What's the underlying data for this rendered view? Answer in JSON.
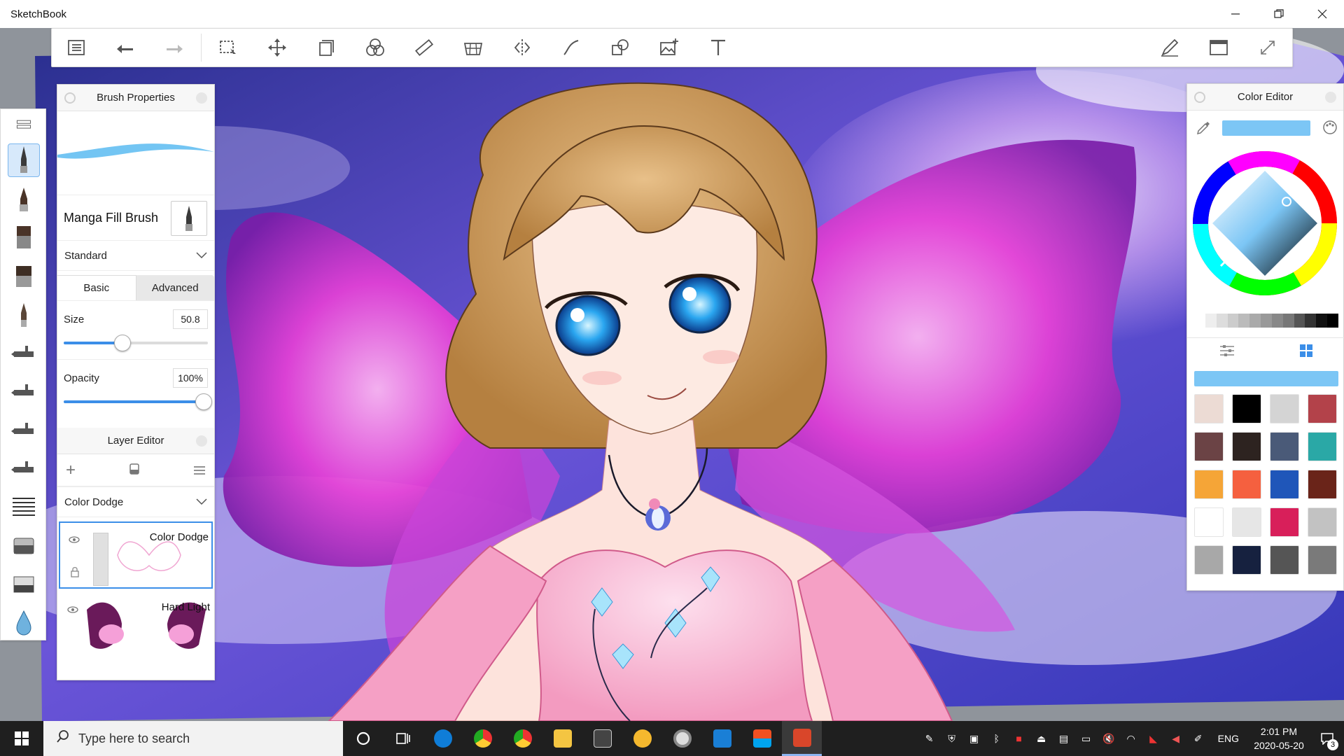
{
  "window": {
    "title": "SketchBook",
    "minimize_icon": "minimize-icon",
    "restore_icon": "restore-icon",
    "close_icon": "close-icon"
  },
  "toolbar": {
    "left_tools": [
      "menu-list-icon",
      "undo-icon",
      "redo-icon"
    ],
    "tools": [
      "select-icon",
      "transform-icon",
      "layer-copy-icon",
      "color-blend-icon",
      "ruler-icon",
      "perspective-icon",
      "symmetry-icon",
      "curve-icon",
      "shape-icon",
      "image-add-icon",
      "text-icon"
    ],
    "right_tools": [
      "brush-edit-icon",
      "window-icon",
      "fullscreen-icon"
    ]
  },
  "toolstrip": {
    "items": [
      "brush-library-icon",
      "manga-fill-brush-icon",
      "ink-brush-icon",
      "flat-brush-icon",
      "wide-brush-icon",
      "pencil-brush-icon",
      "airbrush-1-icon",
      "airbrush-2-icon",
      "airbrush-3-icon",
      "airbrush-4-icon",
      "hatch-brush-icon",
      "eraser-soft-icon",
      "eraser-hard-icon",
      "blur-drop-icon"
    ],
    "active_index": 1
  },
  "brush_panel": {
    "title": "Brush Properties",
    "brush_name": "Manga Fill Brush",
    "preset": "Standard",
    "tab_basic": "Basic",
    "tab_advanced": "Advanced",
    "size_label": "Size",
    "size_value": "50.8",
    "size_fraction": 0.42,
    "opacity_label": "Opacity",
    "opacity_value": "100%",
    "opacity_fraction": 1.0
  },
  "layer_editor": {
    "title": "Layer Editor",
    "blend_mode": "Color Dodge",
    "layers": [
      {
        "name": "Color Dodge",
        "selected": true
      },
      {
        "name": "Hard Light",
        "selected": false
      }
    ]
  },
  "color_editor": {
    "title": "Color Editor",
    "current_color": "#7cc6f5",
    "gray_ramp": [
      "#ffffff",
      "#eeeeee",
      "#dddddd",
      "#cccccc",
      "#bbbbbb",
      "#aaaaaa",
      "#999999",
      "#888888",
      "#777777",
      "#555555",
      "#333333",
      "#111111",
      "#000000"
    ],
    "swatches": [
      "#ecdbd4",
      "#000000",
      "#d4d4d4",
      "#b3424a",
      "#6b4345",
      "#2d2320",
      "#4a5a78",
      "#2aa8a6",
      "#f5a537",
      "#f5603f",
      "#1f56b9",
      "#6a2419",
      "#ffffff",
      "#e6e6e6",
      "#d81f5a",
      "#c2c2c2",
      "#a8a8a8",
      "#16213f",
      "#555555",
      "#7a7a7a"
    ]
  },
  "taskbar": {
    "search_placeholder": "Type here to search",
    "apps": [
      "cortana-icon",
      "task-view-icon",
      "edge-icon",
      "chrome-icon",
      "chrome-2-icon",
      "file-explorer-icon",
      "calculator-icon",
      "weather-icon",
      "media-icon",
      "meet-icon",
      "store-icon",
      "sketchbook-icon"
    ],
    "tray_lang": "ENG",
    "time": "2:01 PM",
    "date": "2020-05-20",
    "notification_count": "3"
  }
}
